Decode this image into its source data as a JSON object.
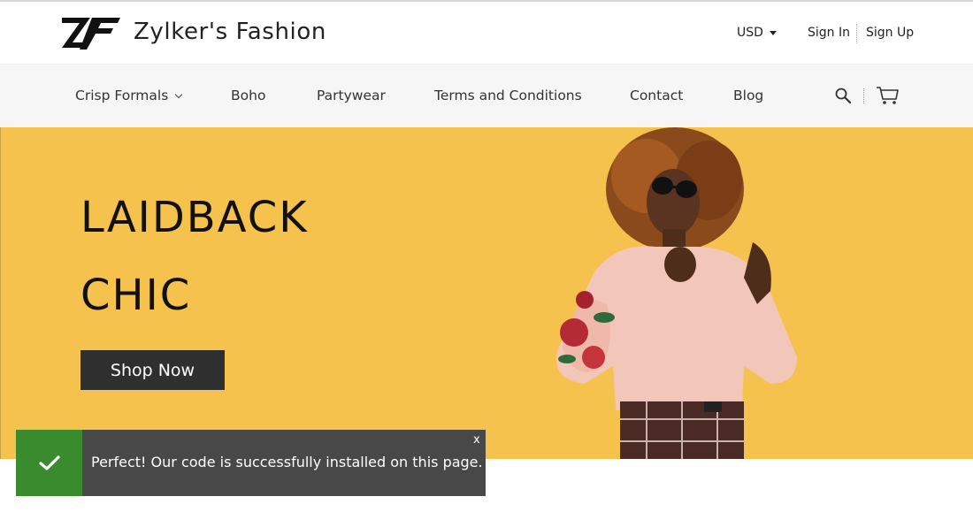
{
  "header": {
    "brand": "Zylker's Fashion",
    "currency": "USD",
    "sign_in": "Sign In",
    "sign_up": "Sign Up"
  },
  "nav": {
    "items": [
      {
        "label": "Crisp Formals",
        "has_dropdown": true
      },
      {
        "label": "Boho"
      },
      {
        "label": "Partywear"
      },
      {
        "label": "Terms and Conditions"
      },
      {
        "label": "Contact"
      },
      {
        "label": "Blog"
      }
    ],
    "icons": [
      "search-icon",
      "cart-icon"
    ]
  },
  "hero": {
    "line1": "LAIDBACK",
    "line2": "CHIC",
    "cta": "Shop Now",
    "background_color": "#f5c24d"
  },
  "toast": {
    "message": "Perfect! Our code is successfully installed on this page.",
    "close": "x",
    "status_color": "#3a8a2e"
  }
}
